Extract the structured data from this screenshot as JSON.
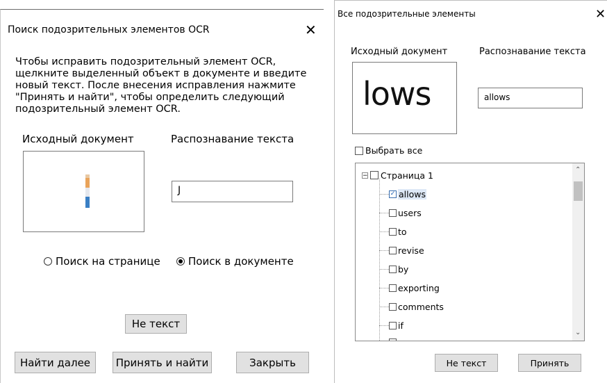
{
  "dialog_left": {
    "title": "Поиск подозрительных элементов OCR",
    "close": "✕",
    "instructions": [
      "Чтобы исправить подозрительный элемент OCR,",
      "щелкните выделенный объект в документе и введите",
      "новый текст. После внесения исправления нажмите",
      "\"Принять и найти\", чтобы определить следующий",
      "подозрительный элемент OCR."
    ],
    "source_label": "Исходный документ",
    "recognition_label": "Распознавание текста",
    "recognition_value": "J",
    "radio_page": "Поиск на странице",
    "radio_document": "Поиск в документе",
    "not_text_button": "Не текст",
    "find_next_button": "Найти далее",
    "accept_find_button": "Принять и найти",
    "close_button": "Закрыть"
  },
  "dialog_right": {
    "title": "Все подозрительные элементы",
    "close": "✕",
    "source_label": "Исходный документ",
    "recognition_label": "Распознавание текста",
    "source_image_text": "lows",
    "recognition_value": "allows",
    "select_all": "Выбрать все",
    "tree": {
      "root": "Страница 1",
      "items": [
        {
          "label": "allows",
          "checked": true
        },
        {
          "label": "users",
          "checked": false
        },
        {
          "label": "to",
          "checked": false
        },
        {
          "label": "revise",
          "checked": false
        },
        {
          "label": "by",
          "checked": false
        },
        {
          "label": "exporting",
          "checked": false
        },
        {
          "label": "comments",
          "checked": false
        },
        {
          "label": "if",
          "checked": false
        }
      ]
    },
    "not_text_button": "Не текст",
    "accept_button": "Принять"
  }
}
